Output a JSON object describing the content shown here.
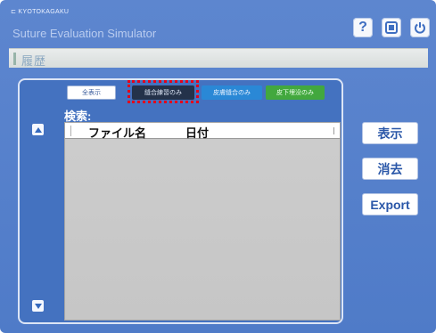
{
  "header": {
    "brand": "KYOTOKAGAKU",
    "app_title": "Suture Evaluation Simulator",
    "help_glyph": "?",
    "icons": [
      "help-icon",
      "home-icon",
      "power-icon"
    ]
  },
  "tab": {
    "label": "履歴"
  },
  "filters": {
    "all": "全表示",
    "suture": "縫合練習のみ",
    "skin": "皮膚縫合のみ",
    "sub": "皮下埋没のみ"
  },
  "search": {
    "label": "検索:"
  },
  "list": {
    "columns": [
      "ファイル名",
      "日付"
    ],
    "rows": []
  },
  "actions": {
    "show": "表示",
    "delete": "消去",
    "export": "Export"
  },
  "colors": {
    "background": "#4f7bc8",
    "panel": "#4472c0",
    "highlight": "#e3001a",
    "filter_suture": "#24324a",
    "filter_skin": "#2a88d6",
    "filter_sub": "#42a83e"
  }
}
